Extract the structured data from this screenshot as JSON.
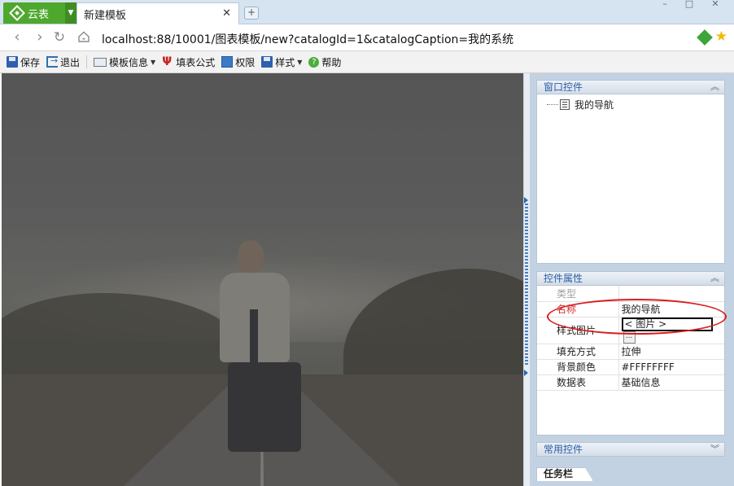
{
  "tabbar": {
    "app_label": "云表",
    "tab_title": "新建模板",
    "close_glyph": "✕",
    "new_tab_glyph": "+",
    "window_controls": [
      "–",
      "□",
      "✕"
    ]
  },
  "addressbar": {
    "url": "localhost:88/10001/图表模板/new?catalogId=1&catalogCaption=我的系统"
  },
  "toolbar": {
    "save": "保存",
    "exit": "退出",
    "template_info": "模板信息",
    "fill_formula": "填表公式",
    "permission": "权限",
    "style": "样式",
    "help": "帮助",
    "help_glyph": "?"
  },
  "panels": {
    "window_controls": {
      "title": "窗口控件",
      "tree": [
        "我的导航"
      ]
    },
    "properties": {
      "title": "控件属性",
      "rows": [
        {
          "key": "类型",
          "value": ""
        },
        {
          "key": "名称",
          "value": "我的导航"
        },
        {
          "key": "样式图片",
          "value": "< 图片 >"
        },
        {
          "key": "填充方式",
          "value": "拉伸"
        },
        {
          "key": "背景颜色",
          "value": "#FFFFFFFF"
        },
        {
          "key": "数据表",
          "value": "基础信息"
        }
      ],
      "ellipsis": "..."
    },
    "common_controls": {
      "title": "常用控件"
    },
    "taskbar": "任务栏"
  },
  "colors": {
    "accent_green": "#4fa82e",
    "panel_title_blue": "#2a5ea8",
    "highlight_red": "#d81e1e"
  },
  "icons": {
    "app_logo": "diamond-logo-icon",
    "back": "arrow-left-icon",
    "forward": "arrow-right-icon",
    "reload": "reload-icon",
    "home": "home-icon",
    "favorite": "star-icon",
    "extension": "green-diamond-icon"
  }
}
